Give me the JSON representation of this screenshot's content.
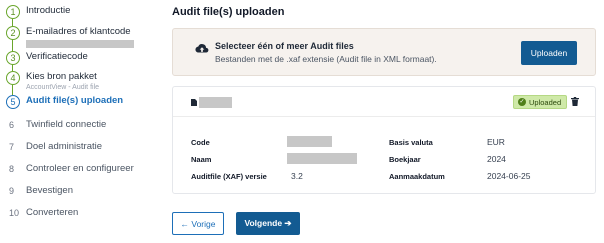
{
  "stepper": {
    "steps": [
      {
        "num": "1",
        "label": "Introductie",
        "state": "done",
        "sub": ""
      },
      {
        "num": "2",
        "label": "E-mailadres of klantcode",
        "state": "done",
        "sub": ""
      },
      {
        "num": "3",
        "label": "Verificatiecode",
        "state": "done",
        "sub": ""
      },
      {
        "num": "4",
        "label": "Kies bron pakket",
        "state": "done",
        "sub": "AccountView - Audit file"
      },
      {
        "num": "5",
        "label": "Audit file(s) uploaden",
        "state": "active",
        "sub": ""
      },
      {
        "num": "6",
        "label": "Twinfield connectie",
        "state": "pending",
        "sub": ""
      },
      {
        "num": "7",
        "label": "Doel administratie",
        "state": "pending",
        "sub": ""
      },
      {
        "num": "8",
        "label": "Controleer en configureer",
        "state": "pending",
        "sub": ""
      },
      {
        "num": "9",
        "label": "Bevestigen",
        "state": "pending",
        "sub": ""
      },
      {
        "num": "10",
        "label": "Converteren",
        "state": "pending",
        "sub": ""
      }
    ]
  },
  "main": {
    "title": "Audit file(s) uploaden",
    "upload": {
      "title": "Selecteer één of meer Audit files",
      "subtitle": "Bestanden met de .xaf extensie (Audit file in XML formaat).",
      "button_label": "Uploaden"
    },
    "file": {
      "status_badge": "Uploaded",
      "labels": {
        "code": "Code",
        "naam": "Naam",
        "auditfile_versie": "Auditfile (XAF) versie",
        "basis_valuta": "Basis valuta",
        "boekjaar": "Boekjaar",
        "aanmaakdatum": "Aanmaakdatum"
      },
      "values": {
        "auditfile_versie": "3.2",
        "basis_valuta": "EUR",
        "boekjaar": "2024",
        "aanmaakdatum": "2024-06-25"
      }
    },
    "nav": {
      "prev_label": "← Vorige",
      "next_label": "Volgende ➔"
    }
  },
  "colors": {
    "done": "#6aa62c",
    "active": "#1d6fb8",
    "primary_button": "#135b92",
    "badge_bg": "#cfe9a8"
  },
  "icons": {
    "upload": "cloud-upload-icon",
    "file": "file-icon",
    "status": "check-circle-icon",
    "delete": "trash-icon"
  }
}
